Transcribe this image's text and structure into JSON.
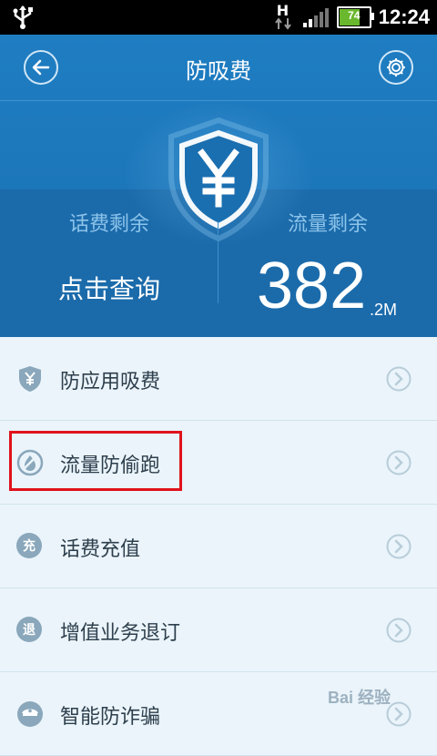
{
  "status_bar": {
    "network_type": "H",
    "battery_level": "74",
    "battery_fraction": 0.74,
    "time": "12:24",
    "icons": [
      "usb-icon",
      "data-arrows-icon",
      "signal-icon",
      "battery-icon"
    ]
  },
  "header": {
    "title": "防吸费",
    "back_icon": "back-arrow-icon",
    "settings_icon": "gear-icon",
    "shield_icon": "yen-shield-icon",
    "balance_label": "话费剩余",
    "balance_action": "点击查询",
    "data_label": "流量剩余",
    "data_value": "382",
    "data_unit": ".2M"
  },
  "menu": {
    "items": [
      {
        "label": "防应用吸费",
        "icon": "yen-shield-icon"
      },
      {
        "label": "流量防偷跑",
        "icon": "drop-slash-icon"
      },
      {
        "label": "话费充值",
        "icon": "charge-icon",
        "glyph": "充"
      },
      {
        "label": "增值业务退订",
        "icon": "unsubscribe-icon",
        "glyph": "退"
      },
      {
        "label": "智能防诈骗",
        "icon": "police-cap-icon"
      }
    ],
    "chevron_icon": "chevron-right-icon"
  },
  "annotation": {
    "highlight_color": "#e0121b"
  },
  "watermark": {
    "text": "Bai 经验"
  },
  "colors": {
    "header_blue": "#1f7dc2",
    "list_bg": "#eaf4fa",
    "icon_gray_blue": "#8aa7bb"
  }
}
